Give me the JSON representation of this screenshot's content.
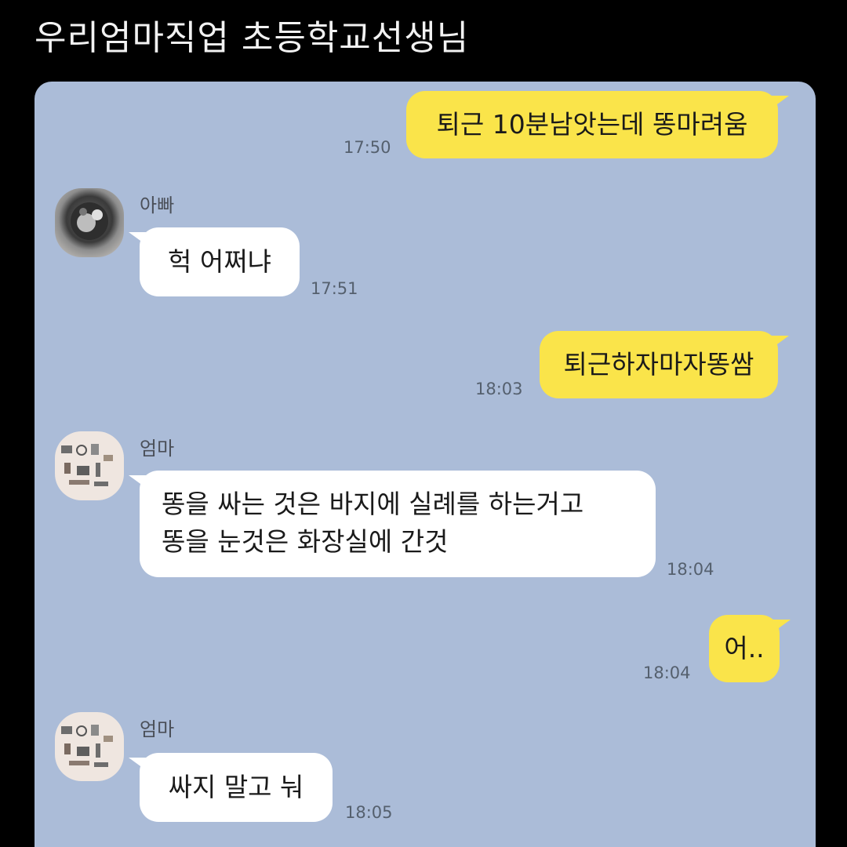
{
  "caption": "우리엄마직업 초등학교선생님",
  "messages": [
    {
      "text": "퇴근 10분남앗는데 똥마려움",
      "time": "17:50"
    },
    {
      "sender": "아빠",
      "text": "헉 어쩌냐",
      "time": "17:51"
    },
    {
      "text": "퇴근하자마자똥쌈",
      "time": "18:03"
    },
    {
      "sender": "엄마",
      "lines": [
        "똥을 싸는 것은 바지에 실례를 하는거고",
        "똥을 눈것은 화장실에 간것"
      ],
      "time": "18:04"
    },
    {
      "text": "어..",
      "time": "18:04"
    },
    {
      "sender": "엄마",
      "text": "싸지 말고 눠",
      "time": "18:05"
    }
  ],
  "colors": {
    "chat_background": "#abbcd8",
    "my_bubble": "#fae44a",
    "other_bubble": "#ffffff",
    "page_background": "#000000"
  },
  "icons": {
    "dad_avatar": "dad-profile-avatar",
    "mom_avatar": "mom-profile-avatar"
  }
}
